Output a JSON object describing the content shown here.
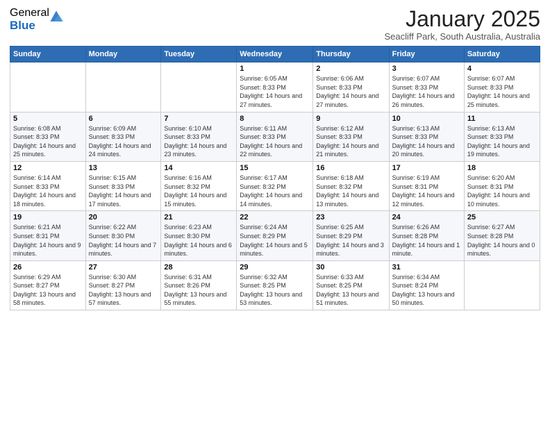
{
  "logo": {
    "general": "General",
    "blue": "Blue"
  },
  "title": {
    "month": "January 2025",
    "location": "Seacliff Park, South Australia, Australia"
  },
  "weekdays": [
    "Sunday",
    "Monday",
    "Tuesday",
    "Wednesday",
    "Thursday",
    "Friday",
    "Saturday"
  ],
  "weeks": [
    [
      {
        "day": "",
        "info": ""
      },
      {
        "day": "",
        "info": ""
      },
      {
        "day": "",
        "info": ""
      },
      {
        "day": "1",
        "info": "Sunrise: 6:05 AM\nSunset: 8:33 PM\nDaylight: 14 hours and 27 minutes."
      },
      {
        "day": "2",
        "info": "Sunrise: 6:06 AM\nSunset: 8:33 PM\nDaylight: 14 hours and 27 minutes."
      },
      {
        "day": "3",
        "info": "Sunrise: 6:07 AM\nSunset: 8:33 PM\nDaylight: 14 hours and 26 minutes."
      },
      {
        "day": "4",
        "info": "Sunrise: 6:07 AM\nSunset: 8:33 PM\nDaylight: 14 hours and 25 minutes."
      }
    ],
    [
      {
        "day": "5",
        "info": "Sunrise: 6:08 AM\nSunset: 8:33 PM\nDaylight: 14 hours and 25 minutes."
      },
      {
        "day": "6",
        "info": "Sunrise: 6:09 AM\nSunset: 8:33 PM\nDaylight: 14 hours and 24 minutes."
      },
      {
        "day": "7",
        "info": "Sunrise: 6:10 AM\nSunset: 8:33 PM\nDaylight: 14 hours and 23 minutes."
      },
      {
        "day": "8",
        "info": "Sunrise: 6:11 AM\nSunset: 8:33 PM\nDaylight: 14 hours and 22 minutes."
      },
      {
        "day": "9",
        "info": "Sunrise: 6:12 AM\nSunset: 8:33 PM\nDaylight: 14 hours and 21 minutes."
      },
      {
        "day": "10",
        "info": "Sunrise: 6:13 AM\nSunset: 8:33 PM\nDaylight: 14 hours and 20 minutes."
      },
      {
        "day": "11",
        "info": "Sunrise: 6:13 AM\nSunset: 8:33 PM\nDaylight: 14 hours and 19 minutes."
      }
    ],
    [
      {
        "day": "12",
        "info": "Sunrise: 6:14 AM\nSunset: 8:33 PM\nDaylight: 14 hours and 18 minutes."
      },
      {
        "day": "13",
        "info": "Sunrise: 6:15 AM\nSunset: 8:33 PM\nDaylight: 14 hours and 17 minutes."
      },
      {
        "day": "14",
        "info": "Sunrise: 6:16 AM\nSunset: 8:32 PM\nDaylight: 14 hours and 15 minutes."
      },
      {
        "day": "15",
        "info": "Sunrise: 6:17 AM\nSunset: 8:32 PM\nDaylight: 14 hours and 14 minutes."
      },
      {
        "day": "16",
        "info": "Sunrise: 6:18 AM\nSunset: 8:32 PM\nDaylight: 14 hours and 13 minutes."
      },
      {
        "day": "17",
        "info": "Sunrise: 6:19 AM\nSunset: 8:31 PM\nDaylight: 14 hours and 12 minutes."
      },
      {
        "day": "18",
        "info": "Sunrise: 6:20 AM\nSunset: 8:31 PM\nDaylight: 14 hours and 10 minutes."
      }
    ],
    [
      {
        "day": "19",
        "info": "Sunrise: 6:21 AM\nSunset: 8:31 PM\nDaylight: 14 hours and 9 minutes."
      },
      {
        "day": "20",
        "info": "Sunrise: 6:22 AM\nSunset: 8:30 PM\nDaylight: 14 hours and 7 minutes."
      },
      {
        "day": "21",
        "info": "Sunrise: 6:23 AM\nSunset: 8:30 PM\nDaylight: 14 hours and 6 minutes."
      },
      {
        "day": "22",
        "info": "Sunrise: 6:24 AM\nSunset: 8:29 PM\nDaylight: 14 hours and 5 minutes."
      },
      {
        "day": "23",
        "info": "Sunrise: 6:25 AM\nSunset: 8:29 PM\nDaylight: 14 hours and 3 minutes."
      },
      {
        "day": "24",
        "info": "Sunrise: 6:26 AM\nSunset: 8:28 PM\nDaylight: 14 hours and 1 minute."
      },
      {
        "day": "25",
        "info": "Sunrise: 6:27 AM\nSunset: 8:28 PM\nDaylight: 14 hours and 0 minutes."
      }
    ],
    [
      {
        "day": "26",
        "info": "Sunrise: 6:29 AM\nSunset: 8:27 PM\nDaylight: 13 hours and 58 minutes."
      },
      {
        "day": "27",
        "info": "Sunrise: 6:30 AM\nSunset: 8:27 PM\nDaylight: 13 hours and 57 minutes."
      },
      {
        "day": "28",
        "info": "Sunrise: 6:31 AM\nSunset: 8:26 PM\nDaylight: 13 hours and 55 minutes."
      },
      {
        "day": "29",
        "info": "Sunrise: 6:32 AM\nSunset: 8:25 PM\nDaylight: 13 hours and 53 minutes."
      },
      {
        "day": "30",
        "info": "Sunrise: 6:33 AM\nSunset: 8:25 PM\nDaylight: 13 hours and 51 minutes."
      },
      {
        "day": "31",
        "info": "Sunrise: 6:34 AM\nSunset: 8:24 PM\nDaylight: 13 hours and 50 minutes."
      },
      {
        "day": "",
        "info": ""
      }
    ]
  ]
}
